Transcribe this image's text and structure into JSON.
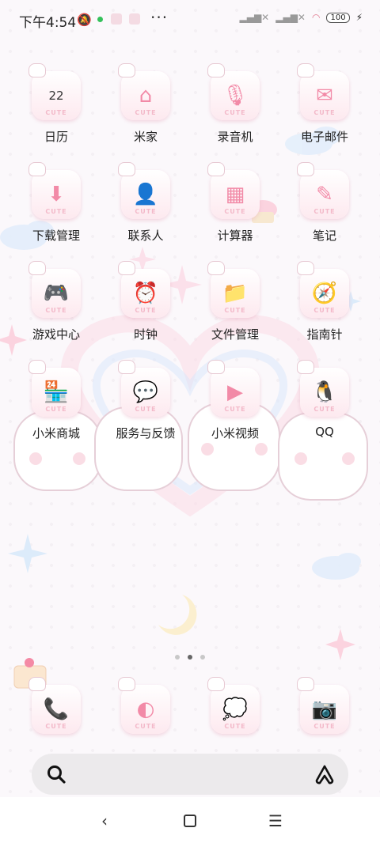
{
  "status_bar": {
    "time": "下午4:54",
    "battery": "100"
  },
  "apps": [
    {
      "label": "日历",
      "icon": "calendar-icon",
      "glyph": "22"
    },
    {
      "label": "米家",
      "icon": "home-icon",
      "glyph": "⌂"
    },
    {
      "label": "录音机",
      "icon": "recorder-icon",
      "glyph": "🎙"
    },
    {
      "label": "电子邮件",
      "icon": "mail-icon",
      "glyph": "✉"
    },
    {
      "label": "下载管理",
      "icon": "download-icon",
      "glyph": "⬇"
    },
    {
      "label": "联系人",
      "icon": "contact-icon",
      "glyph": "👤"
    },
    {
      "label": "计算器",
      "icon": "calculator-icon",
      "glyph": "▦"
    },
    {
      "label": "笔记",
      "icon": "notes-icon",
      "glyph": "✎"
    },
    {
      "label": "游戏中心",
      "icon": "game-icon",
      "glyph": "🎮"
    },
    {
      "label": "时钟",
      "icon": "clock-icon",
      "glyph": "⏰"
    },
    {
      "label": "文件管理",
      "icon": "folder-icon",
      "glyph": "📁"
    },
    {
      "label": "指南针",
      "icon": "compass-icon",
      "glyph": "🧭"
    },
    {
      "label": "小米商城",
      "icon": "store-icon",
      "glyph": "🏪"
    },
    {
      "label": "服务与反馈",
      "icon": "feedback-icon",
      "glyph": "💬"
    },
    {
      "label": "小米视频",
      "icon": "video-icon",
      "glyph": "▶"
    },
    {
      "label": "QQ",
      "icon": "qq-icon",
      "glyph": "🐧"
    }
  ],
  "dock": [
    {
      "icon": "phone-icon",
      "glyph": "📞"
    },
    {
      "icon": "browser-icon",
      "glyph": "◐"
    },
    {
      "icon": "message-icon",
      "glyph": "💭"
    },
    {
      "icon": "camera-icon",
      "glyph": "📷"
    }
  ],
  "pager": {
    "pages": 3,
    "active": 1
  },
  "nav": {
    "back": "back-icon",
    "home": "home-square-icon",
    "menu": "menu-icon"
  }
}
